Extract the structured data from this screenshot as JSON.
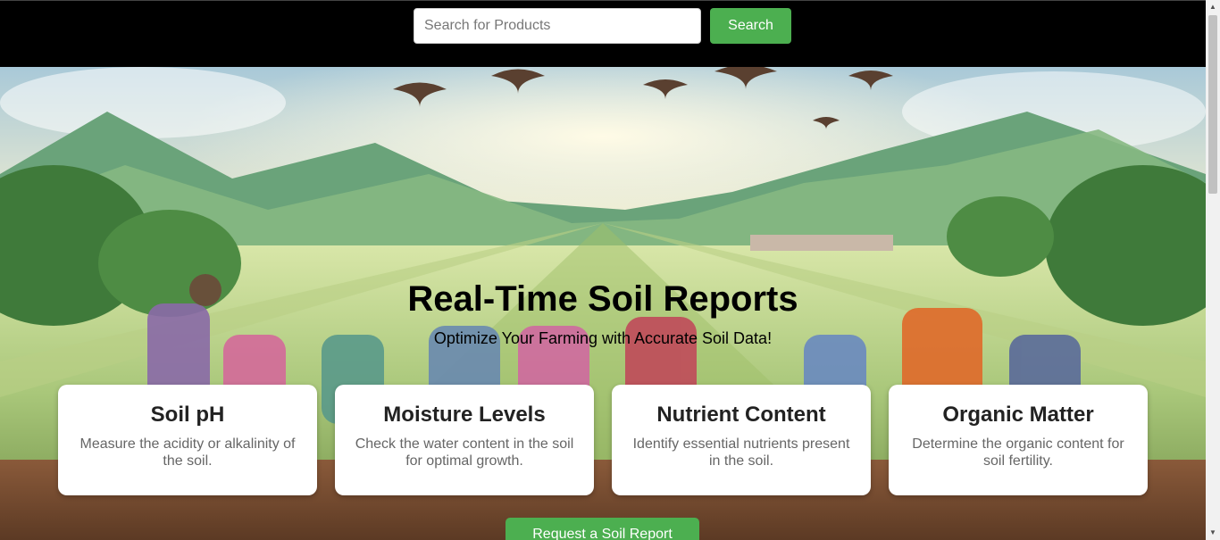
{
  "search": {
    "placeholder": "Search for Products",
    "button_label": "Search"
  },
  "hero": {
    "title": "Real-Time Soil Reports",
    "subtitle": "Optimize Your Farming with Accurate Soil Data!"
  },
  "cards": [
    {
      "title": "Soil pH",
      "description": "Measure the acidity or alkalinity of the soil."
    },
    {
      "title": "Moisture Levels",
      "description": "Check the water content in the soil for optimal growth."
    },
    {
      "title": "Nutrient Content",
      "description": "Identify essential nutrients present in the soil."
    },
    {
      "title": "Organic Matter",
      "description": "Determine the organic content for soil fertility."
    }
  ],
  "cta": {
    "label": "Request a Soil Report"
  },
  "colors": {
    "accent": "#4caf50",
    "header_bg": "#000000"
  },
  "icons": {
    "scroll_up": "scroll-up-arrow-icon",
    "scroll_down": "scroll-down-arrow-icon"
  }
}
